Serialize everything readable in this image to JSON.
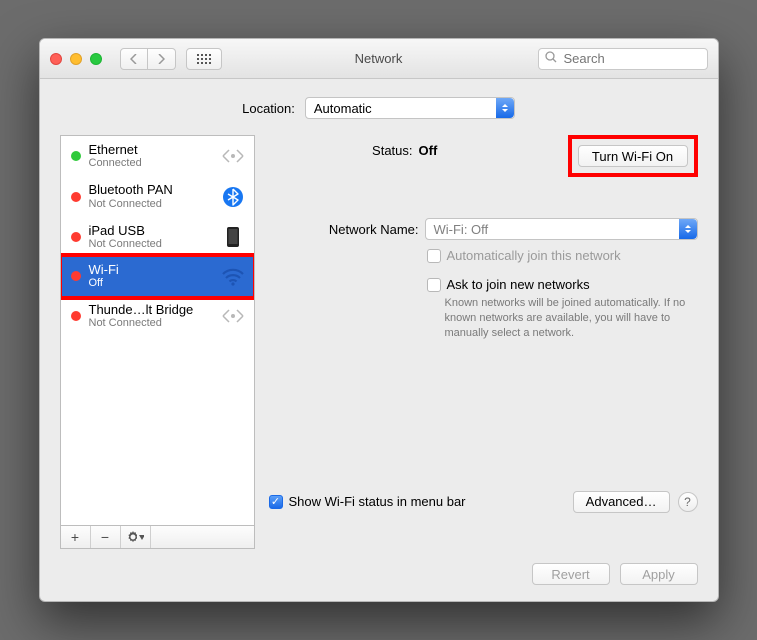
{
  "window": {
    "title": "Network"
  },
  "search": {
    "placeholder": "Search"
  },
  "location": {
    "label": "Location:",
    "value": "Automatic"
  },
  "sidebar": {
    "items": [
      {
        "name": "Ethernet",
        "status": "Connected",
        "dot": "green",
        "icon": "ethernet"
      },
      {
        "name": "Bluetooth PAN",
        "status": "Not Connected",
        "dot": "red",
        "icon": "bluetooth"
      },
      {
        "name": "iPad USB",
        "status": "Not Connected",
        "dot": "red",
        "icon": "ipad"
      },
      {
        "name": "Wi-Fi",
        "status": "Off",
        "dot": "red",
        "icon": "wifi",
        "selected": true
      },
      {
        "name": "Thunde…lt Bridge",
        "status": "Not Connected",
        "dot": "red",
        "icon": "ethernet"
      }
    ]
  },
  "detail": {
    "status_label": "Status:",
    "status_value": "Off",
    "turn_on_label": "Turn Wi-Fi On",
    "network_name_label": "Network Name:",
    "network_name_value": "Wi-Fi: Off",
    "auto_join_label": "Automatically join this network",
    "ask_join_label": "Ask to join new networks",
    "ask_join_help": "Known networks will be joined automatically. If no known networks are available, you will have to manually select a network.",
    "show_menubar_label": "Show Wi-Fi status in menu bar",
    "advanced_label": "Advanced…"
  },
  "footer": {
    "revert": "Revert",
    "apply": "Apply"
  }
}
